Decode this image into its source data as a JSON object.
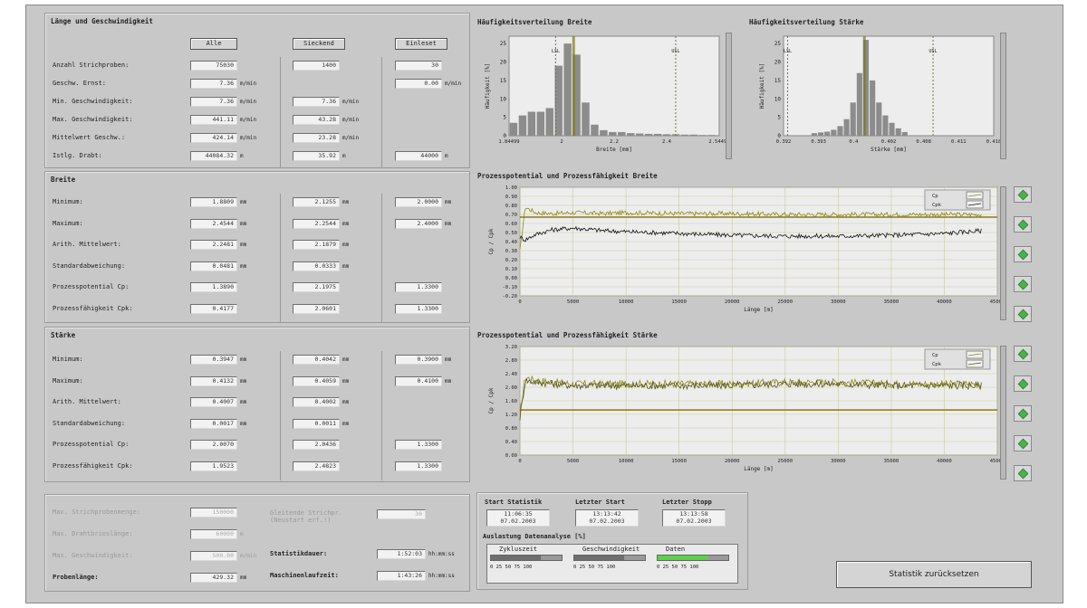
{
  "left": {
    "laenge": {
      "title": "Länge und Geschwindigkeit",
      "col_buttons": [
        "Alle",
        "Sieckend",
        "Einleset"
      ],
      "rows": [
        {
          "label": "Anzahl Strichproben:",
          "v1": "75030",
          "u1": "",
          "v2": "1400",
          "u2": "",
          "v3": "30",
          "u3": ""
        },
        {
          "label": "Geschw. Ernst:",
          "v1": "7.36",
          "u1": "m/min",
          "v2": "",
          "u2": "",
          "v3": "0.00",
          "u3": "m/min"
        },
        {
          "label": "Min. Geschwindigkeit:",
          "v1": "7.36",
          "u1": "m/min",
          "v2": "7.36",
          "u2": "m/min",
          "v3": "",
          "u3": ""
        },
        {
          "label": "Max. Geschwindigkeit:",
          "v1": "441.11",
          "u1": "m/min",
          "v2": "43.28",
          "u2": "m/min",
          "v3": "",
          "u3": ""
        },
        {
          "label": "Mittelwert Geschw.:",
          "v1": "424.14",
          "u1": "m/min",
          "v2": "23.28",
          "u2": "m/min",
          "v3": "",
          "u3": ""
        },
        {
          "label": "Istlg. Drabt:",
          "v1": "44084.32",
          "u1": "m",
          "v2": "35.92",
          "u2": "m",
          "v3": "44000",
          "u3": "m"
        }
      ]
    },
    "breite": {
      "title": "Breite",
      "rows": [
        {
          "label": "Minimum:",
          "v1": "1.8809",
          "u1": "mm",
          "v2": "2.1255",
          "u2": "mm",
          "v3": "2.0000",
          "u3": "mm"
        },
        {
          "label": "Maximum:",
          "v1": "2.4544",
          "u1": "mm",
          "v2": "2.2544",
          "u2": "mm",
          "v3": "2.4000",
          "u3": "mm"
        },
        {
          "label": "Arith. Mittelwert:",
          "v1": "2.2481",
          "u1": "mm",
          "v2": "2.1879",
          "u2": "mm",
          "v3": "",
          "u3": ""
        },
        {
          "label": "Standardabweichung:",
          "v1": "0.0481",
          "u1": "mm",
          "v2": "0.0333",
          "u2": "mm",
          "v3": "",
          "u3": ""
        },
        {
          "label": "Prozesspotential Cp:",
          "v1": "1.3890",
          "u1": "",
          "v2": "2.1975",
          "u2": "",
          "v3": "1.3300",
          "u3": ""
        },
        {
          "label": "Prozessfähigkeit Cpk:",
          "v1": "0.4177",
          "u1": "",
          "v2": "2.0601",
          "u2": "",
          "v3": "1.3300",
          "u3": ""
        }
      ]
    },
    "staerke": {
      "title": "Stärke",
      "rows": [
        {
          "label": "Minimum:",
          "v1": "0.3947",
          "u1": "mm",
          "v2": "0.4042",
          "u2": "mm",
          "v3": "0.3900",
          "u3": "mm"
        },
        {
          "label": "Maximum:",
          "v1": "0.4132",
          "u1": "mm",
          "v2": "0.4059",
          "u2": "mm",
          "v3": "0.4100",
          "u3": "mm"
        },
        {
          "label": "Arith. Mittelwert:",
          "v1": "0.4007",
          "u1": "mm",
          "v2": "0.4002",
          "u2": "mm",
          "v3": "",
          "u3": ""
        },
        {
          "label": "Standardabweichung:",
          "v1": "0.0017",
          "u1": "mm",
          "v2": "0.0011",
          "u2": "mm",
          "v3": "",
          "u3": ""
        },
        {
          "label": "Prozesspotential Cp:",
          "v1": "2.0070",
          "u1": "",
          "v2": "2.0436",
          "u2": "",
          "v3": "1.3300",
          "u3": ""
        },
        {
          "label": "Prozessfähigkeit Cpk:",
          "v1": "1.9523",
          "u1": "",
          "v2": "2.4823",
          "u2": "",
          "v3": "1.3300",
          "u3": ""
        }
      ]
    },
    "misc": {
      "rows_left": [
        {
          "label": "Max. Strichprobenmenge:",
          "value": "150000",
          "unit": "",
          "disabled": true
        },
        {
          "label": "Max. Drahtbrieslänge:",
          "value": "60000",
          "unit": "m",
          "disabled": true
        },
        {
          "label": "Max. Geschwindigkeit:",
          "value": "500.00",
          "unit": "m/min",
          "disabled": true
        },
        {
          "label": "Probenlänge:",
          "value": "429.32",
          "unit": "mm",
          "disabled": false
        }
      ],
      "gleitende_label": "Gleitende Strichpr. (Neustart erf.!)",
      "gleitende_value": "30",
      "statistik_label": "Statistikdauer:",
      "statistik_value": "1:52:03",
      "statistik_unit": "hh:mm:ss",
      "maschinen_label": "Maschinenlaufzeit:",
      "maschinen_value": "1:43:26",
      "maschinen_unit": "hh:mm:ss"
    }
  },
  "hist_breite": {
    "title": "Häufigkeitsverteilung Breite",
    "ylabel": "Häufigkeit [%]",
    "xlabel": "Breite [mm]",
    "lsl_label": "LSL",
    "usl_label": "USL"
  },
  "hist_staerke": {
    "title": "Häufigkeitsverteilung Stärke",
    "ylabel": "Häufigkeit [%]",
    "xlabel": "Stärke [mm]",
    "lsl_label": "LSL",
    "usl_label": "USL"
  },
  "proc_breite": {
    "title": "Prozesspotential und Prozessfähigkeit Breite",
    "ylabel": "Cp / Cpk",
    "xlabel": "Länge [m]",
    "legend": [
      "Cp",
      "Cpk"
    ]
  },
  "proc_staerke": {
    "title": "Prozesspotential und Prozessfähigkeit Stärke",
    "ylabel": "Cp / Cpk",
    "xlabel": "Länge [m]",
    "legend": [
      "Cp",
      "Cpk"
    ]
  },
  "status": {
    "start_label": "Start Statistik",
    "start_time": "11:06:35",
    "start_date": "07.02.2003",
    "last_start_label": "Letzter Start",
    "last_start_time": "13:13:42",
    "last_start_date": "07.02.2003",
    "last_stop_label": "Letzter Stopp",
    "last_stop_time": "13:13:58",
    "last_stop_date": "07.02.2003",
    "auslastung_label": "Auslastung Datenanalyse [%]",
    "bars": [
      {
        "label": "Zykluszeit",
        "value": 70
      },
      {
        "label": "Geschwindigkeit",
        "value": 70
      },
      {
        "label": "Daten",
        "value": 72
      }
    ],
    "bar_ticks": "0  25  50  75 100"
  },
  "reset_button": "Statistik zurücksetzen",
  "chart_data": [
    {
      "type": "bar",
      "title": "Häufigkeitsverteilung Breite",
      "xlabel": "Breite [mm]",
      "ylabel": "Häufigkeit [%]",
      "x_tick_labels": [
        "1.84499",
        "2",
        "2.2",
        "2.4",
        "2.54499"
      ],
      "y_ticks": [
        0,
        5,
        10,
        15,
        20,
        25
      ],
      "ylim": [
        0,
        27
      ],
      "xlim": [
        1.845,
        2.545
      ],
      "lsl": 2.0,
      "usl": 2.4,
      "mean_line": 2.06,
      "bin_width": 0.0285,
      "bin_centers": [
        1.86,
        1.89,
        1.92,
        1.95,
        1.98,
        2.01,
        2.04,
        2.07,
        2.1,
        2.13,
        2.16,
        2.19,
        2.22,
        2.25,
        2.28,
        2.31,
        2.34,
        2.37,
        2.4,
        2.43,
        2.46,
        2.49,
        2.52
      ],
      "values": [
        3.5,
        5.5,
        6.5,
        6.5,
        7.5,
        19,
        25,
        22,
        9,
        3,
        1.5,
        1,
        1,
        0.7,
        0.6,
        0.5,
        0.5,
        0.4,
        0.4,
        0.3,
        0.3,
        0.2,
        0.2
      ]
    },
    {
      "type": "bar",
      "title": "Häufigkeitsverteilung Stärke",
      "xlabel": "Stärke [mm]",
      "ylabel": "Häufigkeit [%]",
      "x_tick_labels": [
        "0.392",
        "0.393",
        "0.4",
        "0.402",
        "0.408",
        "0.411",
        "0.418"
      ],
      "y_ticks": [
        0,
        5,
        10,
        15,
        20,
        25
      ],
      "ylim": [
        0,
        27
      ],
      "xlim": [
        0.3925,
        0.4185
      ],
      "lsl": 0.393,
      "usl": 0.411,
      "mean_line": 0.4025,
      "bin_width": 0.0008,
      "bin_centers": [
        0.3963,
        0.3971,
        0.3979,
        0.3987,
        0.3995,
        0.4003,
        0.4011,
        0.4019,
        0.4027,
        0.4035,
        0.4043,
        0.4051,
        0.4059,
        0.4067,
        0.4075
      ],
      "values": [
        0.7,
        0.9,
        1.1,
        1.6,
        2.6,
        4.5,
        9,
        17,
        26,
        15,
        9,
        5.5,
        3.5,
        2,
        1
      ]
    },
    {
      "type": "line",
      "title": "Prozesspotential und Prozessfähigkeit Breite",
      "xlabel": "Länge [m]",
      "ylabel": "Cp / Cpk",
      "x_ticks": [
        0,
        5000,
        10000,
        15000,
        20000,
        25000,
        30000,
        35000,
        40000,
        45000
      ],
      "y_ticks": [
        -0.2,
        -0.1,
        0,
        0.1,
        0.2,
        0.3,
        0.4,
        0.5,
        0.6,
        0.7,
        0.8,
        0.9,
        1.0
      ],
      "y_tick_labels": [
        "-0.20",
        "-0.10",
        "0.00",
        "0.10",
        "0.20",
        "0.30",
        "0.40",
        "0.50",
        "0.60",
        "0.70",
        "0.80",
        "0.90",
        "1.00"
      ],
      "xlim": [
        0,
        45000
      ],
      "ylim": [
        -0.2,
        1.0
      ],
      "reference_line": 0.67,
      "series": [
        {
          "name": "Cp",
          "color": "#8a8a1a",
          "x": [
            0,
            500,
            1500,
            3000,
            5000,
            8000,
            10000,
            15000,
            20000,
            25000,
            30000,
            35000,
            40000,
            43500
          ],
          "y": [
            0.3,
            0.78,
            0.72,
            0.71,
            0.72,
            0.71,
            0.72,
            0.71,
            0.71,
            0.7,
            0.7,
            0.7,
            0.7,
            0.7
          ]
        },
        {
          "name": "Cpk",
          "color": "#111111",
          "x": [
            0,
            500,
            1500,
            3000,
            5000,
            8000,
            10000,
            15000,
            20000,
            25000,
            30000,
            35000,
            40000,
            43500
          ],
          "y": [
            0.45,
            0.42,
            0.48,
            0.53,
            0.55,
            0.52,
            0.51,
            0.49,
            0.47,
            0.46,
            0.46,
            0.47,
            0.49,
            0.52
          ]
        }
      ]
    },
    {
      "type": "line",
      "title": "Prozesspotential und Prozessfähigkeit Stärke",
      "xlabel": "Länge [m]",
      "ylabel": "Cp / Cpk",
      "x_ticks": [
        0,
        5000,
        10000,
        15000,
        20000,
        25000,
        30000,
        35000,
        40000,
        45000
      ],
      "y_ticks": [
        0,
        0.4,
        0.8,
        1.2,
        1.6,
        2.0,
        2.4,
        2.8,
        3.2
      ],
      "y_tick_labels": [
        "0.00",
        "0.40",
        "0.80",
        "1.20",
        "1.60",
        "2.00",
        "2.40",
        "2.80",
        "3.20"
      ],
      "xlim": [
        0,
        45000
      ],
      "ylim": [
        0,
        3.2
      ],
      "reference_line": 1.33,
      "series": [
        {
          "name": "Cp",
          "color": "#8a8a1a",
          "x": [
            0,
            500,
            1500,
            5000,
            10000,
            15000,
            20000,
            25000,
            30000,
            35000,
            40000,
            43500
          ],
          "y": [
            1.2,
            2.3,
            2.2,
            2.1,
            2.1,
            2.1,
            2.1,
            2.15,
            2.15,
            2.1,
            2.1,
            2.1
          ]
        },
        {
          "name": "Cpk",
          "color": "#55551a",
          "x": [
            0,
            500,
            1500,
            5000,
            10000,
            15000,
            20000,
            25000,
            30000,
            35000,
            40000,
            43500
          ],
          "y": [
            1.1,
            2.2,
            2.15,
            2.05,
            2.05,
            2.05,
            2.05,
            2.1,
            2.1,
            2.05,
            2.05,
            2.05
          ]
        }
      ]
    }
  ]
}
